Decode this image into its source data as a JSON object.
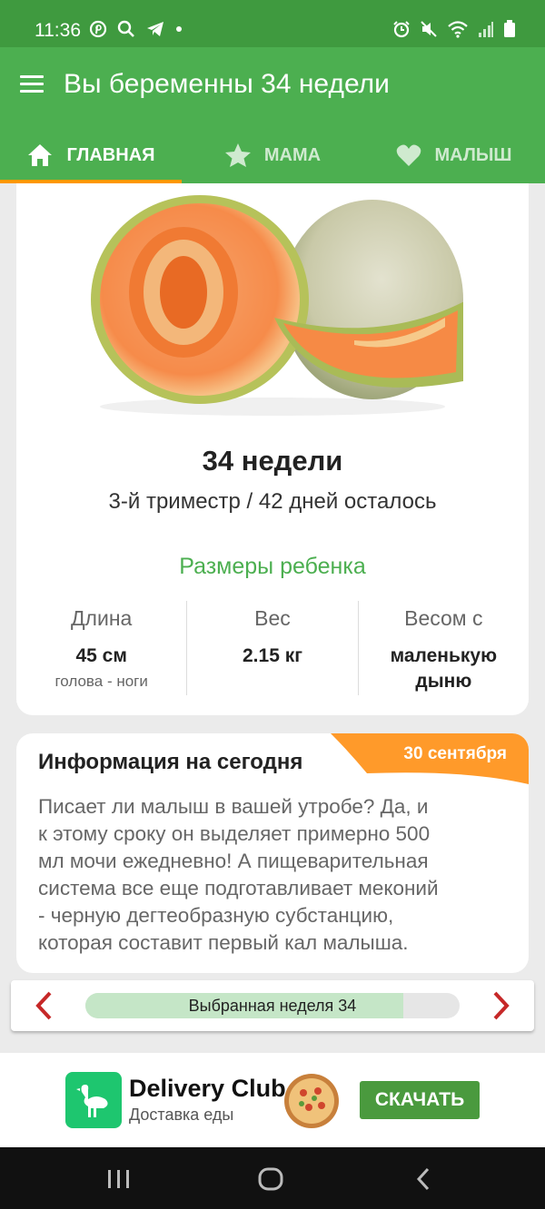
{
  "status_bar": {
    "time": "11:36",
    "left_icons": [
      "pinterest-icon",
      "search-icon",
      "telegram-icon",
      "dot-icon"
    ],
    "right_icons": [
      "alarm-icon",
      "mute-icon",
      "wifi-icon",
      "signal-icon",
      "battery-icon"
    ]
  },
  "app_bar": {
    "title": "Вы беременны 34 недели"
  },
  "tabs": [
    {
      "label": "ГЛАВНАЯ",
      "icon": "home-icon",
      "active": true
    },
    {
      "label": "МАМА",
      "icon": "star-icon",
      "active": false
    },
    {
      "label": "МАЛЫШ",
      "icon": "heart-icon",
      "active": false
    }
  ],
  "week_card": {
    "image": "cantaloupe-melon-image",
    "week_title": "34 недели",
    "trimester_text": "3-й триместр / 42 дней осталось",
    "sizes_title": "Размеры ребенка",
    "stats": [
      {
        "label": "Длина",
        "value": "45 см",
        "sub": "голова - ноги"
      },
      {
        "label": "Вес",
        "value": "2.15 кг",
        "sub": ""
      },
      {
        "label": "Весом с",
        "value_line1": "маленькую",
        "value_line2": "дыню"
      }
    ]
  },
  "info_card": {
    "title": "Информация на сегодня",
    "date": "30 сентября",
    "lines": [
      "Писает ли малыш в вашей утробе? Да, и",
      "к этому сроку он выделяет примерно 500",
      "мл мочи ежедневно! А пищеварительная",
      "система все еще подготавливает меконий",
      "- черную дегтеобразную субстанцию,",
      "которая составит первый кал малыша."
    ]
  },
  "week_selector": {
    "label": "Выбранная неделя 34",
    "progress_fraction": 0.85,
    "prev_icon": "chevron-left-icon",
    "next_icon": "chevron-right-icon"
  },
  "ad": {
    "brand": "Delivery Club",
    "description": "Доставка еды",
    "button": "СКАЧАТЬ"
  },
  "colors": {
    "status_bar": "#3f9a3f",
    "primary": "#4caf50",
    "accent": "#ff9800",
    "arrow": "#c62828"
  }
}
